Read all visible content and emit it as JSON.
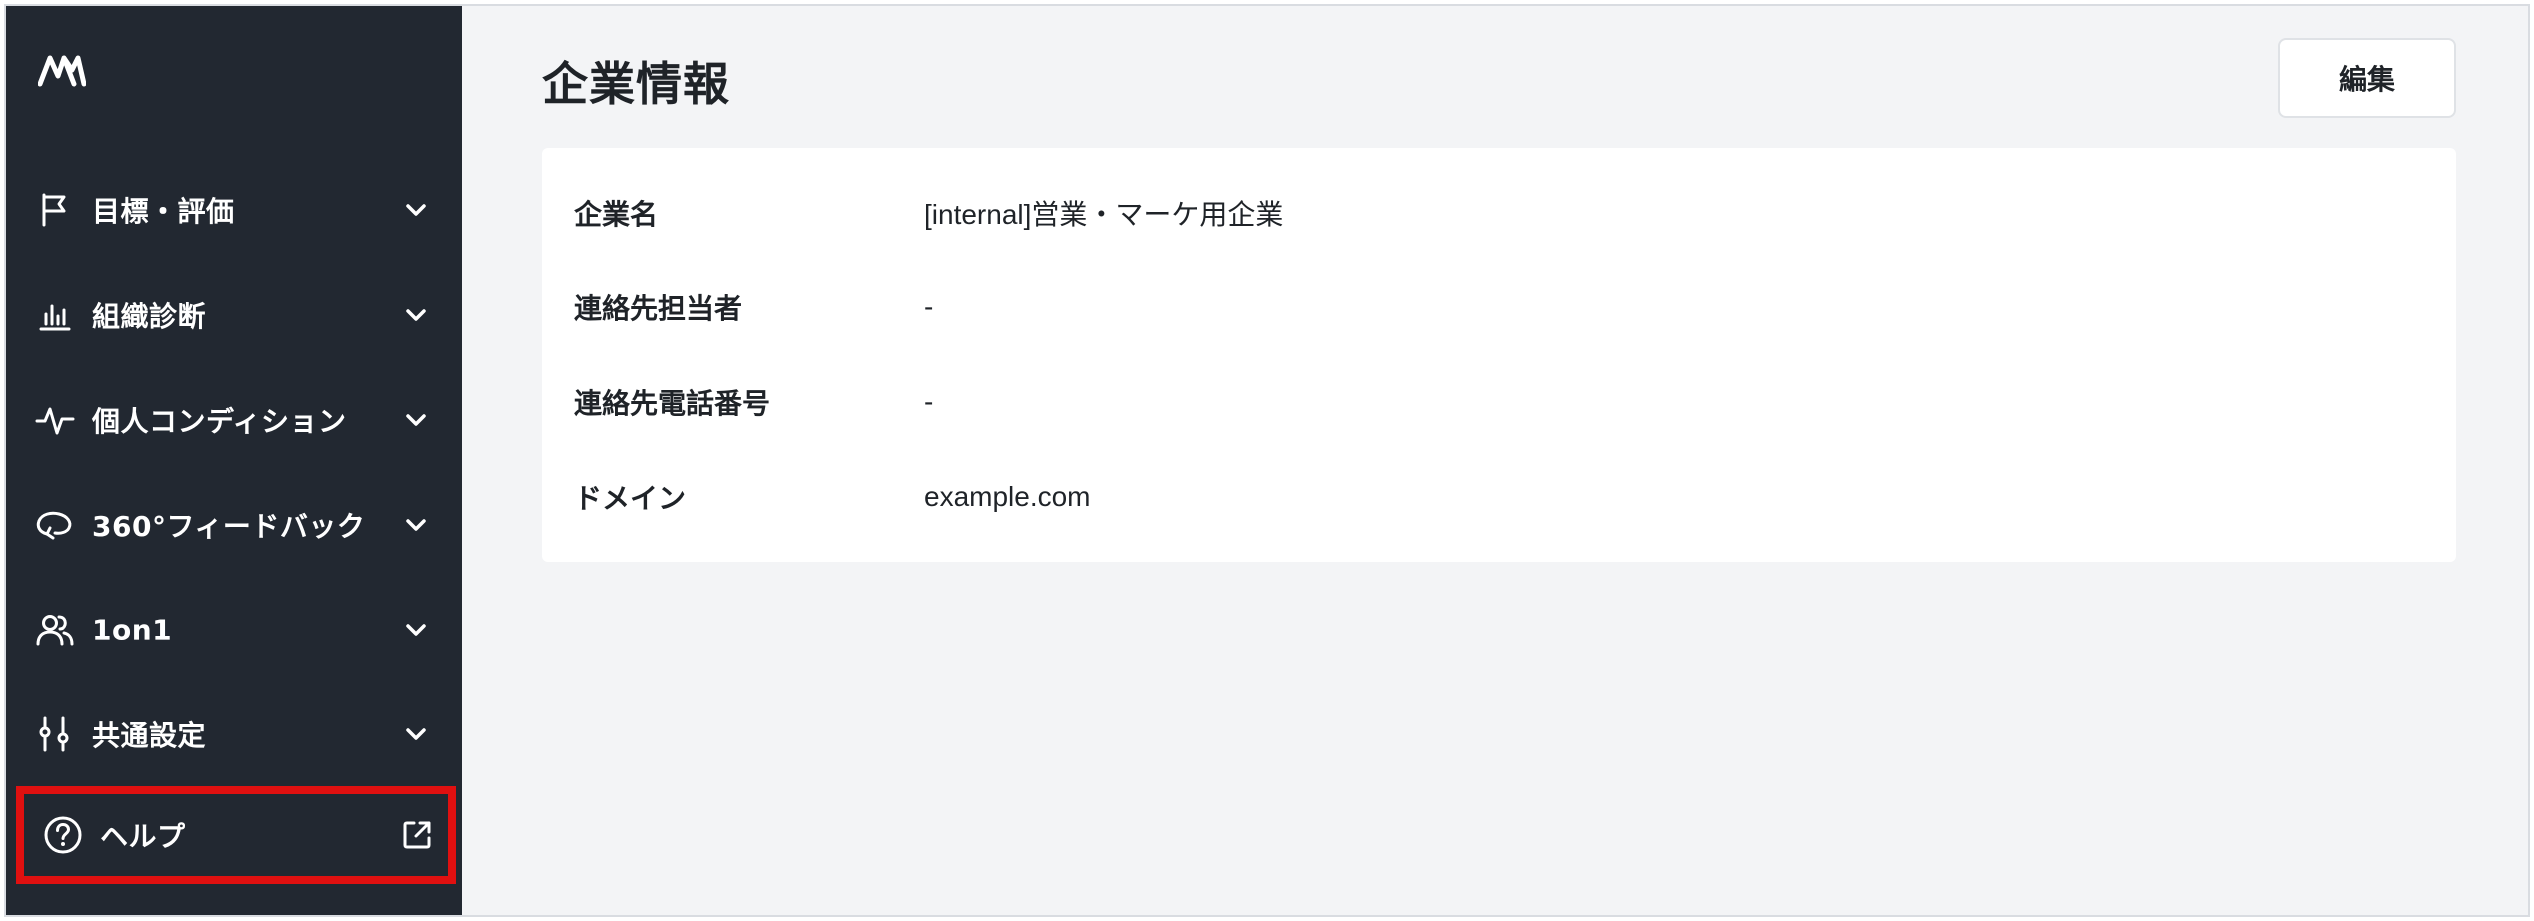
{
  "sidebar": {
    "logo_icon": "brand-logo-icon",
    "items": [
      {
        "label": "目標・評価",
        "icon": "flag-icon"
      },
      {
        "label": "組織診断",
        "icon": "bar-chart-icon"
      },
      {
        "label": "個人コンディション",
        "icon": "pulse-icon"
      },
      {
        "label": "360°フィードバック",
        "icon": "feedback-loop-icon"
      },
      {
        "label": "1on1",
        "icon": "users-icon"
      },
      {
        "label": "共通設定",
        "icon": "sliders-icon"
      }
    ],
    "help": {
      "label": "ヘルプ",
      "icon": "help-circle-icon",
      "external_icon": "external-link-icon",
      "highlight_color": "#e01010"
    }
  },
  "main": {
    "title": "企業情報",
    "edit_label": "編集",
    "fields": [
      {
        "key": "企業名",
        "value": "[internal]営業・マーケ用企業"
      },
      {
        "key": "連絡先担当者",
        "value": "-"
      },
      {
        "key": "連絡先電話番号",
        "value": "-"
      },
      {
        "key": "ドメイン",
        "value": "example.com"
      }
    ]
  },
  "colors": {
    "sidebar_bg": "#222831",
    "page_bg": "#f3f4f6",
    "card_bg": "#ffffff",
    "text": "#1f2328"
  }
}
